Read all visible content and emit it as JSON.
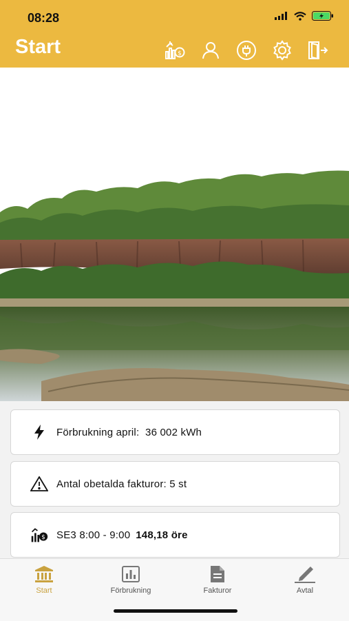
{
  "status_bar": {
    "time": "08:28"
  },
  "header": {
    "title": "Start"
  },
  "header_icons": [
    "price-chart-icon",
    "user-icon",
    "plug-icon",
    "gear-icon",
    "logout-icon"
  ],
  "hero": {
    "image": "quarry-lake-landscape"
  },
  "cards": [
    {
      "icon": "bolt-icon",
      "text": "Förbrukning april:  36 002 kWh",
      "value": ""
    },
    {
      "icon": "warning-icon",
      "text": "Antal obetalda fakturor: 5 st",
      "value": ""
    },
    {
      "icon": "price-chart-icon",
      "text": "SE3 8:00 - 9:00",
      "value": "148,18 öre"
    }
  ],
  "tabs": [
    {
      "label": "Start",
      "icon": "bank-icon",
      "active": true
    },
    {
      "label": "Förbrukning",
      "icon": "bar-chart-icon",
      "active": false
    },
    {
      "label": "Fakturor",
      "icon": "document-icon",
      "active": false
    },
    {
      "label": "Avtal",
      "icon": "pen-icon",
      "active": false
    }
  ],
  "colors": {
    "accent": "#ECB940",
    "active_tab": "#C9A23F"
  }
}
